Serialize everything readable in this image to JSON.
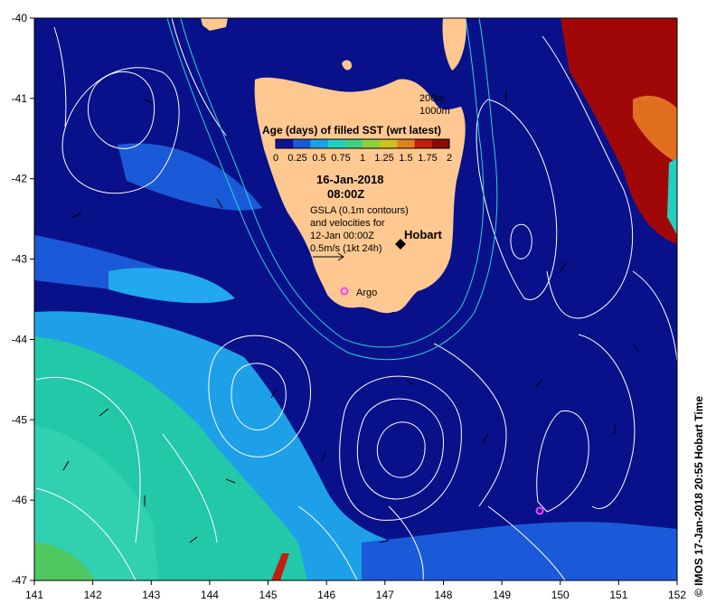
{
  "map": {
    "lon_ticks": [
      "141",
      "142",
      "143",
      "144",
      "145",
      "146",
      "147",
      "148",
      "149",
      "150",
      "151",
      "152"
    ],
    "lat_ticks": [
      "-40",
      "-41",
      "-42",
      "-43",
      "-44",
      "-45",
      "-46",
      "-47"
    ],
    "colorbar": {
      "title": "Age (days) of filled SST (wrt latest)",
      "labels": [
        "0",
        "0.25",
        "0.5",
        "0.75",
        "1",
        "1.25",
        "1.5",
        "1.75",
        "2"
      ],
      "colors": [
        "#10109a",
        "#1a5ad8",
        "#1ea0e8",
        "#22d0c0",
        "#40d080",
        "#90d040",
        "#d0c020",
        "#e08020",
        "#c02010",
        "#8a0a0a"
      ]
    },
    "date_line1": "16-Jan-2018",
    "date_line2": "08:00Z",
    "note_lines": [
      "GSLA (0.1m contours)",
      "and velocities for",
      "12-Jan 00:00Z",
      "0.5m/s (1kt 24h)"
    ],
    "depth_200": "200m",
    "depth_1000": "1000m",
    "city": "Hobart",
    "argo_label": "Argo",
    "credit": "© IMOS 17-Jan-2018 20:55 Hobart Time",
    "colors": {
      "ocean_deep": "#08118a",
      "land": "#ffc890",
      "contour": "#ffffff",
      "isobath": "#30d0d8",
      "argo": "#ff40ff"
    }
  }
}
